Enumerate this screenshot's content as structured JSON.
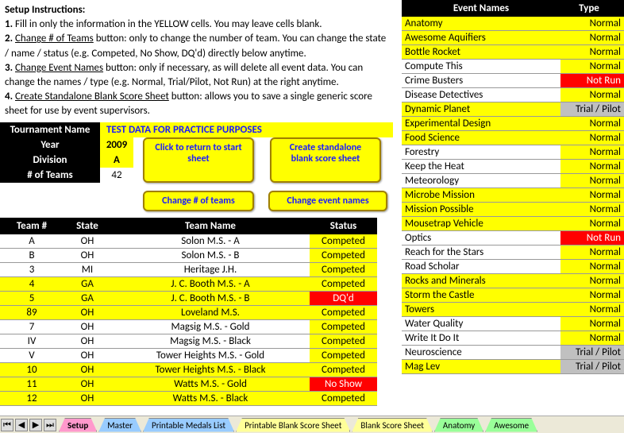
{
  "instructions": {
    "title": "Setup Instructions:",
    "line1a": "1.",
    "line1b": " Fill in only the information in the YELLOW cells.  You may leave cells blank.",
    "line2a": "2. ",
    "line2b": "Change # of Teams",
    "line2c": " button: only to change the number of team.  You can change the state / name / status (e.g. Competed, No Show, DQ'd) directly below anytime.",
    "line3a": "3. ",
    "line3b": "Change Event Names",
    "line3c": " button: only if necessary, as will delete all event data.  You can change the names / type (e.g. Normal, Trial/Pilot, Not Run) at the right anytime.",
    "line4a": "4. ",
    "line4b": "Create Standalone Blank Score Sheet",
    "line4c": " button:  allows you to save a single generic score sheet for use by event supervisors."
  },
  "info": {
    "tname_label": "Tournament Name",
    "tname_val": "TEST DATA FOR PRACTICE PURPOSES",
    "year_label": "Year",
    "year_val": "2009",
    "div_label": "Division",
    "div_val": "A",
    "num_label": "# of Teams",
    "num_val": "42"
  },
  "buttons": {
    "return": "Click to return to start sheet",
    "standalone": "Create standalone blank score sheet",
    "change_teams": "Change # of teams",
    "change_events": "Change event names"
  },
  "team_header": {
    "c1": "Team #",
    "c2": "State",
    "c3": "Team Name",
    "c4": "Status"
  },
  "teams": [
    {
      "n": "A",
      "s": "OH",
      "name": "Solon M.S. - A",
      "st": "Competed",
      "hl": false,
      "red": false
    },
    {
      "n": "B",
      "s": "OH",
      "name": "Solon M.S. - B",
      "st": "Competed",
      "hl": false,
      "red": false
    },
    {
      "n": "3",
      "s": "MI",
      "name": "Heritage J.H.",
      "st": "Competed",
      "hl": false,
      "red": false
    },
    {
      "n": "4",
      "s": "GA",
      "name": "J. C. Booth M.S. - A",
      "st": "Competed",
      "hl": true,
      "red": false
    },
    {
      "n": "5",
      "s": "GA",
      "name": "J. C. Booth M.S. - B",
      "st": "DQ'd",
      "hl": true,
      "red": true
    },
    {
      "n": "89",
      "s": "OH",
      "name": "Loveland M.S.",
      "st": "Competed",
      "hl": true,
      "red": false
    },
    {
      "n": "7",
      "s": "OH",
      "name": "Magsig M.S. - Gold",
      "st": "Competed",
      "hl": false,
      "red": false
    },
    {
      "n": "IV",
      "s": "OH",
      "name": "Magsig M.S. - Black",
      "st": "Competed",
      "hl": false,
      "red": false
    },
    {
      "n": "V",
      "s": "OH",
      "name": "Tower Heights M.S. - Gold",
      "st": "Competed",
      "hl": false,
      "red": false
    },
    {
      "n": "10",
      "s": "OH",
      "name": "Tower Heights M.S. - Black",
      "st": "Competed",
      "hl": true,
      "red": false
    },
    {
      "n": "11",
      "s": "OH",
      "name": "Watts M.S. - Gold",
      "st": "No Show",
      "hl": true,
      "red": true
    },
    {
      "n": "12",
      "s": "OH",
      "name": "Watts M.S. - Black",
      "st": "Competed",
      "hl": true,
      "red": false
    }
  ],
  "ev_header": {
    "c1": "Event Names",
    "c2": "Type"
  },
  "events": [
    {
      "n": "Anatomy",
      "t": "Normal",
      "tc": "y",
      "hl": true
    },
    {
      "n": "Awesome Aquifiers",
      "t": "Normal",
      "tc": "y",
      "hl": true
    },
    {
      "n": "Bottle Rocket",
      "t": "Normal",
      "tc": "y",
      "hl": true
    },
    {
      "n": "Compute This",
      "t": "Normal",
      "tc": "y",
      "hl": false
    },
    {
      "n": "Crime Busters",
      "t": "Not Run",
      "tc": "r",
      "hl": false
    },
    {
      "n": "Disease Detectives",
      "t": "Normal",
      "tc": "y",
      "hl": false
    },
    {
      "n": "Dynamic Planet",
      "t": "Trial / Pilot",
      "tc": "g",
      "hl": true
    },
    {
      "n": "Experimental Design",
      "t": "Normal",
      "tc": "y",
      "hl": true
    },
    {
      "n": "Food Science",
      "t": "Normal",
      "tc": "y",
      "hl": true
    },
    {
      "n": "Forestry",
      "t": "Normal",
      "tc": "y",
      "hl": false
    },
    {
      "n": "Keep the Heat",
      "t": "Normal",
      "tc": "y",
      "hl": false
    },
    {
      "n": "Meteorology",
      "t": "Normal",
      "tc": "y",
      "hl": false
    },
    {
      "n": "Microbe Mission",
      "t": "Normal",
      "tc": "y",
      "hl": true
    },
    {
      "n": "Mission Possible",
      "t": "Normal",
      "tc": "y",
      "hl": true
    },
    {
      "n": "Mousetrap Vehicle",
      "t": "Normal",
      "tc": "y",
      "hl": true
    },
    {
      "n": "Optics",
      "t": "Not Run",
      "tc": "r",
      "hl": false
    },
    {
      "n": "Reach for the Stars",
      "t": "Normal",
      "tc": "y",
      "hl": false
    },
    {
      "n": "Road Scholar",
      "t": "Normal",
      "tc": "y",
      "hl": false
    },
    {
      "n": "Rocks and Minerals",
      "t": "Normal",
      "tc": "y",
      "hl": true
    },
    {
      "n": "Storm the Castle",
      "t": "Normal",
      "tc": "y",
      "hl": true
    },
    {
      "n": "Towers",
      "t": "Normal",
      "tc": "y",
      "hl": true
    },
    {
      "n": "Water Quality",
      "t": "Normal",
      "tc": "y",
      "hl": false
    },
    {
      "n": "Write It Do It",
      "t": "Normal",
      "tc": "y",
      "hl": false
    },
    {
      "n": "Neuroscience",
      "t": "Trial / Pilot",
      "tc": "g",
      "hl": false
    },
    {
      "n": "Mag Lev",
      "t": "Trial / Pilot",
      "tc": "g",
      "hl": true
    }
  ],
  "tabs": [
    {
      "label": "Setup",
      "color": "#ff99cc",
      "active": true
    },
    {
      "label": "Master",
      "color": "#99ccff"
    },
    {
      "label": "Printable Medals List",
      "color": "#99ccff"
    },
    {
      "label": "Printable Blank Score Sheet",
      "color": "#ffff99"
    },
    {
      "label": "Blank Score Sheet",
      "color": "#ffff99"
    },
    {
      "label": "Anatomy",
      "color": "#99ff99"
    },
    {
      "label": "Awesome",
      "color": "#99ff99"
    }
  ]
}
